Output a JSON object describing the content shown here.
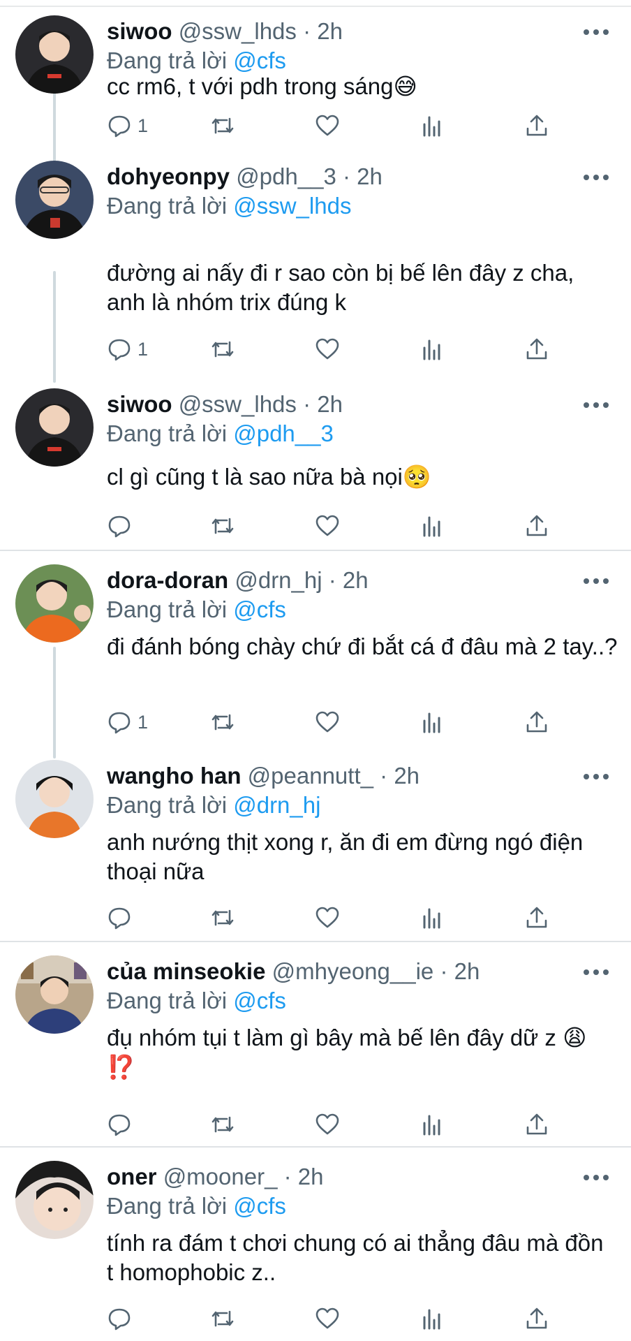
{
  "reply_prefix": "Đang trả lời",
  "tweets": [
    {
      "name": "siwoo",
      "handle": "@ssw_lhds",
      "time": "2h",
      "reply_to": "@cfs",
      "text": "cc rm6, t với pdh trong sáng😅",
      "reply_count": "1",
      "avatar_colors": {
        "bg": "#2a2a2e",
        "accent": "#d63a2f"
      }
    },
    {
      "name": "dohyeonpy",
      "handle": "@pdh__3",
      "time": "2h",
      "reply_to": "@ssw_lhds",
      "text": "đường ai nấy đi r sao còn bị bế lên đây z cha, anh là nhóm trix đúng k",
      "reply_count": "1",
      "avatar_colors": {
        "bg": "#3b4a66",
        "accent": "#c93a2f"
      }
    },
    {
      "name": "siwoo",
      "handle": "@ssw_lhds",
      "time": "2h",
      "reply_to": "@pdh__3",
      "text": "cl gì cũng t là sao nữa bà nọi🥺",
      "reply_count": "",
      "avatar_colors": {
        "bg": "#2a2a2e",
        "accent": "#d63a2f"
      }
    },
    {
      "name": "dora-doran",
      "handle": "@drn_hj",
      "time": "2h",
      "reply_to": "@cfs",
      "text": "đi đánh bóng chày chứ đi bắt cá đ đâu mà 2 tay..?",
      "reply_count": "1",
      "avatar_colors": {
        "bg": "#6c8f55",
        "accent": "#ec6a1f"
      }
    },
    {
      "name": "wangho han",
      "handle": "@peannutt_",
      "time": "2h",
      "reply_to": "@drn_hj",
      "text": "anh nướng thịt xong r, ăn đi em đừng ngó điện thoại nữa",
      "reply_count": "",
      "avatar_colors": {
        "bg": "#dfe3e8",
        "accent": "#e8762a"
      }
    },
    {
      "name": "của minseokie",
      "handle": "@mhyeong__ie",
      "time": "2h",
      "reply_to": "@cfs",
      "text": "đụ nhóm tụi t làm gì bây mà bế lên đây dữ z 😩 ⁉️",
      "reply_count": "",
      "avatar_colors": {
        "bg": "#b8a58a",
        "accent": "#2d3f7a"
      }
    },
    {
      "name": "oner",
      "handle": "@mooner_",
      "time": "2h",
      "reply_to": "@cfs",
      "text": "tính ra đám t chơi chung có ai thẳng đâu mà đồn t homophobic z..",
      "reply_count": "",
      "avatar_colors": {
        "bg": "#e6dcd6",
        "accent": "#1c1c1c"
      }
    }
  ],
  "icons": {
    "reply": "reply-icon",
    "retweet": "retweet-icon",
    "like": "heart-icon",
    "views": "views-icon",
    "share": "share-icon",
    "more": "more-icon"
  },
  "colors": {
    "secondary_text": "#536471",
    "mention": "#1d9bf0",
    "thread_line": "#cfd9de"
  }
}
